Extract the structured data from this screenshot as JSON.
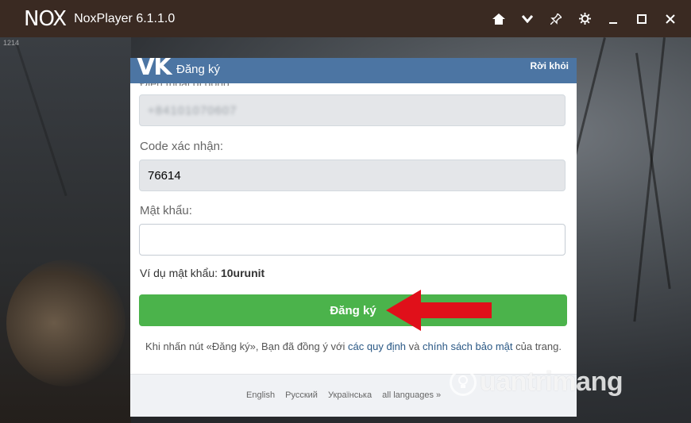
{
  "titlebar": {
    "logo": "NOX",
    "app_title": "NoxPlayer 6.1.1.0",
    "controls": [
      "home-icon",
      "chevron-down-icon",
      "pin-icon",
      "gear-icon",
      "minimize-icon",
      "maximize-icon",
      "close-icon"
    ]
  },
  "corner_text": "1214",
  "dialog": {
    "logo": "VK",
    "title": "Đăng ký",
    "exit": "Rời khỏi",
    "phone_label": "Điện thoại di động:",
    "phone_value": "+84101070607",
    "code_label": "Code xác nhận:",
    "code_value": "76614",
    "password_label": "Mật khẩu:",
    "password_value": "",
    "hint_prefix": "Ví dụ mật khẩu:",
    "hint_example": "10urunit",
    "submit_label": "Đăng ký",
    "terms_prefix": "Khi nhấn nút «Đăng ký», Bạn đã đồng ý với",
    "terms_link1": "các quy định",
    "terms_and": "và",
    "terms_link2": "chính sách bảo mật",
    "terms_suffix": "của trang.",
    "languages": [
      "English",
      "Русский",
      "Українська",
      "all languages »"
    ]
  },
  "watermark": {
    "text": "uantrimang"
  },
  "colors": {
    "titlebar": "#3a2a22",
    "vk_header": "#4c75a3",
    "submit": "#4bb34b",
    "link": "#2a5885",
    "arrow": "#e0101a"
  }
}
